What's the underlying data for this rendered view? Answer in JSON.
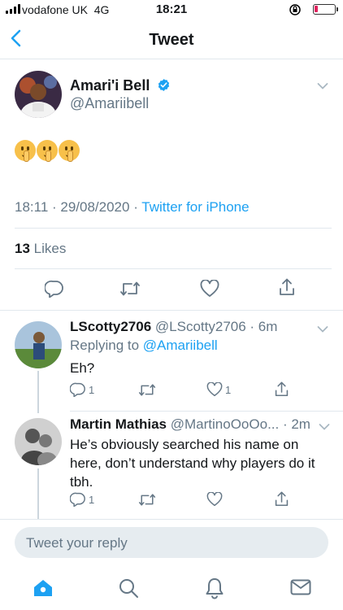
{
  "status_bar": {
    "carrier": "vodafone UK",
    "network": "4G",
    "time": "18:21"
  },
  "nav": {
    "title": "Tweet"
  },
  "tweet": {
    "author_name": "Amari'i Bell",
    "author_handle": "@Amariibell",
    "verified": true,
    "text_emoji": "🤫🤫🤫",
    "timestamp": "18:11 · 29/08/2020 · ",
    "source": "Twitter for iPhone",
    "likes_count": "13",
    "likes_label": "Likes"
  },
  "replies": [
    {
      "name": "LScotty2706",
      "handle": "@LScotty2706",
      "time": "· 6m",
      "replying_label": "Replying to ",
      "replying_to": "@Amariibell",
      "text": "Eh?",
      "reply_count": "1",
      "retweet_count": "",
      "like_count": "1"
    },
    {
      "name": "Martin Mathias",
      "handle": "@MartinoOoOo...",
      "time": "· 2m",
      "text": "He’s obviously searched his name on here, don’t understand why players do it tbh.",
      "reply_count": "1",
      "retweet_count": "",
      "like_count": ""
    }
  ],
  "compose": {
    "placeholder": "Tweet your reply"
  },
  "tab_bar": [
    "home-icon",
    "search-icon",
    "notifications-icon",
    "messages-icon"
  ],
  "colors": {
    "accent": "#1da1f2",
    "muted": "#657786",
    "divider": "#e1e8ed",
    "battery_low": "#e0245e"
  }
}
